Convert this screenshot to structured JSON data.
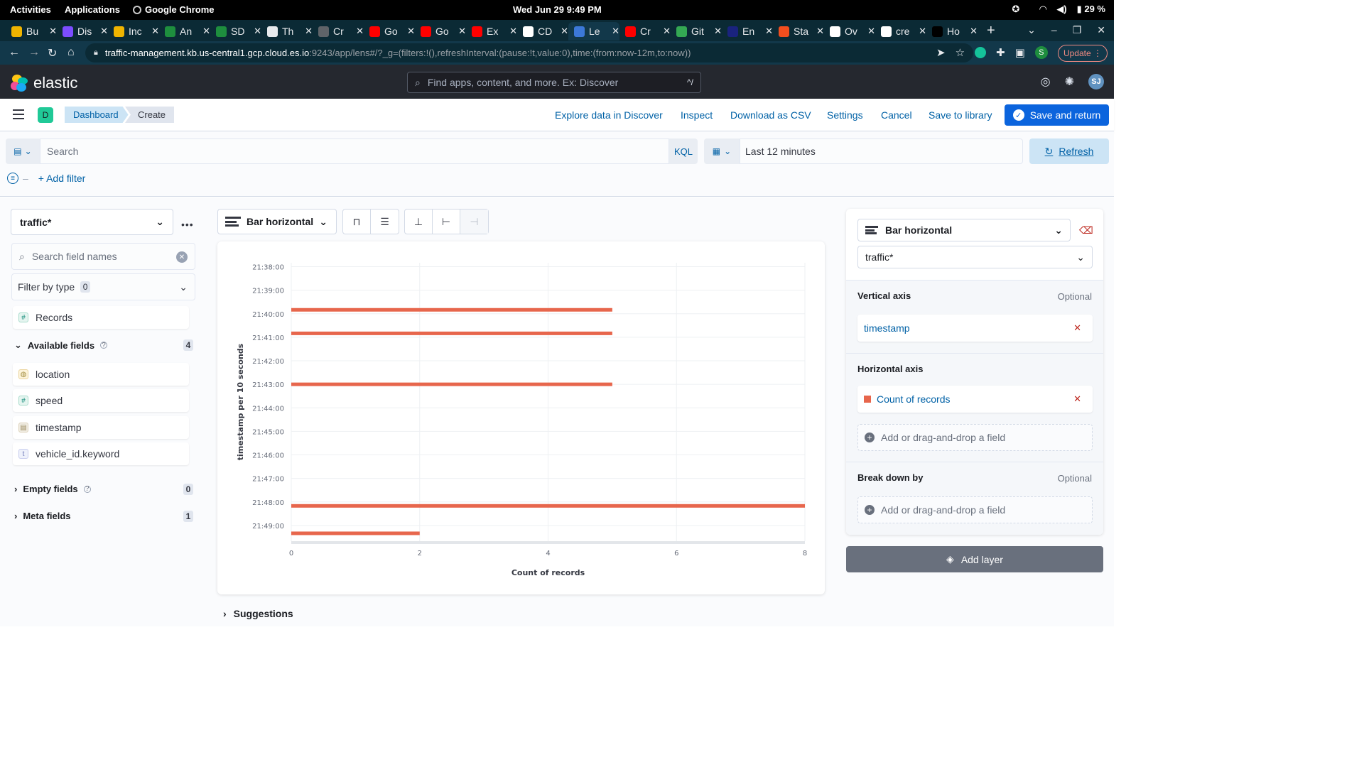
{
  "os_bar": {
    "activities": "Activities",
    "applications": "Applications",
    "app_name": "Google Chrome",
    "datetime": "Wed Jun 29   9:49 PM",
    "battery": "29 %"
  },
  "browser": {
    "tabs": [
      {
        "label": "Bu",
        "color": "#f0b400"
      },
      {
        "label": "Dis",
        "color": "#7c4dff"
      },
      {
        "label": "Inc",
        "color": "#f0b400"
      },
      {
        "label": "An",
        "color": "#1e8e3e"
      },
      {
        "label": "SD",
        "color": "#1e8e3e"
      },
      {
        "label": "Th",
        "color": "#e8eaed"
      },
      {
        "label": "Cr",
        "color": "#5f6368"
      },
      {
        "label": "Go",
        "color": "#ff0000"
      },
      {
        "label": "Go",
        "color": "#ff0000"
      },
      {
        "label": "Ex",
        "color": "#ff0000"
      },
      {
        "label": "CD",
        "color": "#ffffff"
      },
      {
        "label": "Le",
        "color": "#3c78d8"
      },
      {
        "label": "Cr",
        "color": "#ff0000"
      },
      {
        "label": "Git",
        "color": "#34a853"
      },
      {
        "label": "En",
        "color": "#1a237e"
      },
      {
        "label": "Sta",
        "color": "#f24e1e"
      },
      {
        "label": "Ov",
        "color": "#ffffff"
      },
      {
        "label": "cre",
        "color": "#ffffff"
      },
      {
        "label": "Ho",
        "color": "#000000"
      }
    ],
    "url_host": "traffic-management.kb.us-central1.gcp.cloud.es.io",
    "url_path": ":9243/app/lens#/?_g=(filters:!(),refreshInterval:(pause:!t,value:0),time:(from:now-12m,to:now))",
    "profile_initial": "S",
    "update_label": "Update"
  },
  "kibana": {
    "brand": "elastic",
    "search_placeholder": "Find apps, content, and more. Ex: Discover",
    "search_shortcut": "^/",
    "avatar": "SJ",
    "space_initial": "D",
    "breadcrumbs": [
      "Dashboard",
      "Create"
    ],
    "actions": {
      "explore": "Explore data in Discover",
      "inspect": "Inspect",
      "download": "Download as CSV",
      "settings": "Settings",
      "cancel": "Cancel",
      "save_library": "Save to library",
      "save_return": "Save and return"
    },
    "query": {
      "placeholder": "Search",
      "language": "KQL",
      "time_range": "Last 12 minutes",
      "refresh": "Refresh",
      "add_filter": "+ Add filter"
    }
  },
  "left_panel": {
    "data_view": "traffic*",
    "field_search_placeholder": "Search field names",
    "filter_by_type": "Filter by type",
    "filter_count": "0",
    "records": "Records",
    "available_label": "Available fields",
    "available_count": "4",
    "fields": [
      {
        "name": "location",
        "type": "geo"
      },
      {
        "name": "speed",
        "type": "num"
      },
      {
        "name": "timestamp",
        "type": "date"
      },
      {
        "name": "vehicle_id.keyword",
        "type": "str"
      }
    ],
    "empty_label": "Empty fields",
    "empty_count": "0",
    "meta_label": "Meta fields",
    "meta_count": "1"
  },
  "workspace": {
    "chart_type": "Bar horizontal",
    "suggestions": "Suggestions"
  },
  "chart_data": {
    "type": "bar",
    "orientation": "horizontal",
    "categories": [
      "21:38:00",
      "21:39:00",
      "21:40:00",
      "21:41:00",
      "21:42:00",
      "21:43:00",
      "21:44:00",
      "21:45:00",
      "21:46:00",
      "21:47:00",
      "21:48:00",
      "21:49:00"
    ],
    "bars": [
      {
        "y": "21:39:50",
        "value": 5
      },
      {
        "y": "21:40:50",
        "value": 5
      },
      {
        "y": "21:43:00",
        "value": 5
      },
      {
        "y": "21:48:10",
        "value": 8
      },
      {
        "y": "21:49:20",
        "value": 2
      }
    ],
    "xlim": [
      0,
      8
    ],
    "xticks": [
      "0",
      "2",
      "4",
      "6",
      "8"
    ],
    "xlabel": "Count of records",
    "ylabel": "timestamp per 10 seconds",
    "bar_color": "#e7664c",
    "grid": true
  },
  "right_panel": {
    "chart_type": "Bar horizontal",
    "data_view": "traffic*",
    "vertical_axis": "Vertical axis",
    "optional": "Optional",
    "vertical_field": "timestamp",
    "horizontal_axis": "Horizontal axis",
    "horizontal_field": "Count of records",
    "add_field": "Add or drag-and-drop a field",
    "breakdown": "Break down by",
    "add_layer": "Add layer"
  }
}
